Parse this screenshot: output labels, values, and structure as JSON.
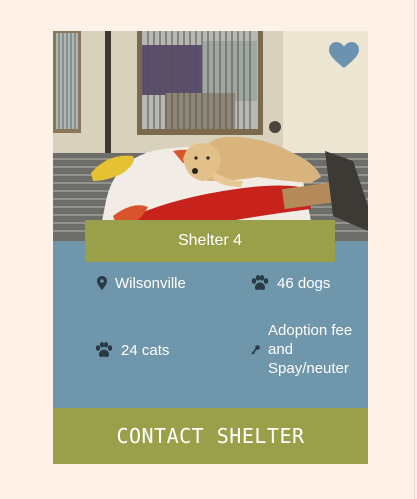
{
  "card": {
    "name": "Shelter 4",
    "location": "Wilsonville",
    "dogs": "46 dogs",
    "cats": "24 cats",
    "fee_lines": [
      "Adoption fee",
      "and",
      "Spay/neuter"
    ],
    "contact_label": "CONTACT SHELTER"
  },
  "icons": {
    "favorite": "heart-icon",
    "location": "map-pin-icon",
    "dogs": "paw-icon",
    "cats": "paw-icon",
    "fee": "key-icon"
  },
  "colors": {
    "page_bg": "#fdf1e8",
    "card_bg": "#6f96aa",
    "accent_olive": "#9aa04a",
    "heart": "#6b93b0",
    "icon_dark": "#2a3a44"
  }
}
